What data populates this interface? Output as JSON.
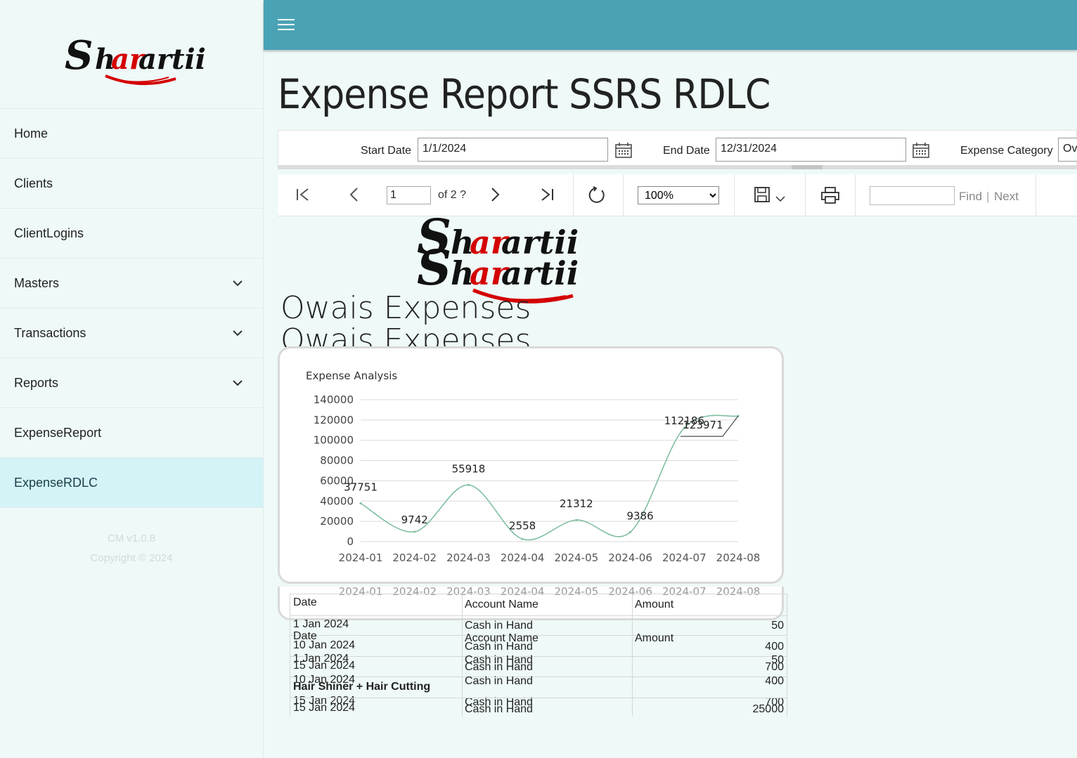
{
  "sidebar": {
    "brand": "Shararttii",
    "items": [
      {
        "label": "Home",
        "has_children": false
      },
      {
        "label": "Clients",
        "has_children": false
      },
      {
        "label": "ClientLogins",
        "has_children": false
      },
      {
        "label": "Masters",
        "has_children": true
      },
      {
        "label": "Transactions",
        "has_children": true
      },
      {
        "label": "Reports",
        "has_children": true
      },
      {
        "label": "ExpenseReport",
        "has_children": false
      },
      {
        "label": "ExpenseRDLC",
        "has_children": false,
        "active": true
      }
    ],
    "version": "CM v1.0.8",
    "copyright": "Copyright © 2024"
  },
  "header": {
    "menu_icon": "hamburger-icon"
  },
  "page": {
    "title": "Expense Report SSRS RDLC"
  },
  "params": {
    "start_label": "Start Date",
    "start_value": "1/1/2024",
    "end_label": "End Date",
    "end_value": "12/31/2024",
    "category_label": "Expense Category",
    "category_value": "Ov"
  },
  "toolbar": {
    "page_value": "1",
    "page_of": "of 2 ?",
    "zoom": "100%",
    "zoom_options": [
      "100%"
    ],
    "find_label": "Find",
    "next_label": "Next"
  },
  "report": {
    "title": "Owais Expenses",
    "table": {
      "headers": [
        "Date",
        "Account Name",
        "Amount"
      ],
      "rows": [
        [
          "1 Jan 2024",
          "Cash in Hand",
          "50"
        ],
        [
          "10 Jan 2024",
          "Cash in Hand",
          "400"
        ],
        [
          "15 Jan 2024",
          "Cash in Hand",
          "700"
        ]
      ],
      "ghost_rows": [
        [
          "1 Jan 2024",
          "Cash in Hand",
          "50"
        ],
        [
          "10 Jan 2024",
          "Cash in Hand",
          "400"
        ],
        [
          "15 Jan 2024",
          "Cash in Hand",
          "700"
        ]
      ],
      "group_label": "Hair Shiner + Hair Cutting",
      "group_row": [
        "15 Jan 2024",
        "Cash in Hand",
        "25000"
      ]
    }
  },
  "chart_data": {
    "type": "line",
    "title": "Expense Analysis",
    "categories": [
      "2024-01",
      "2024-02",
      "2024-03",
      "2024-04",
      "2024-05",
      "2024-06",
      "2024-07",
      "2024-08"
    ],
    "series": [
      {
        "values": [
          37751,
          9742,
          55918,
          2558,
          21312,
          9386,
          112186,
          123971
        ]
      }
    ],
    "ylim": [
      0,
      140000
    ],
    "yticks": [
      0,
      20000,
      40000,
      60000,
      80000,
      100000,
      120000,
      140000
    ],
    "grid": true,
    "line_color": "#7fbf9f"
  }
}
